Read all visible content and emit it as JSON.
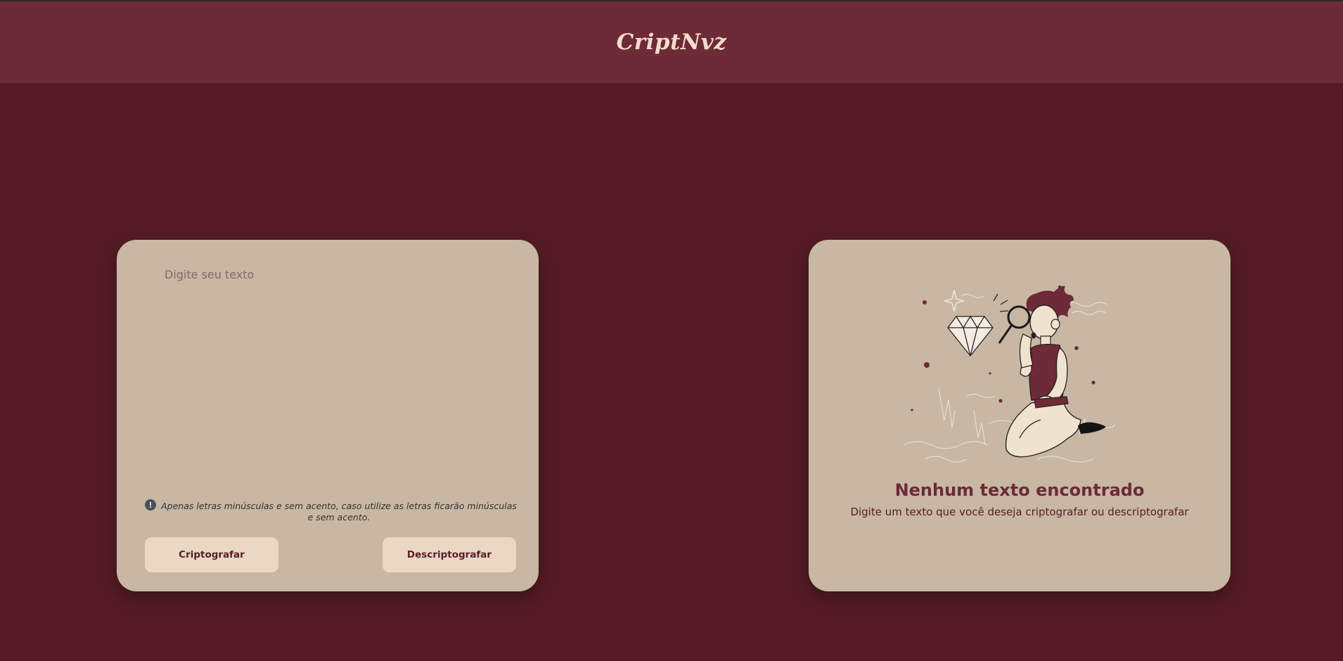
{
  "header": {
    "brand": "CriptNvz"
  },
  "input_card": {
    "placeholder": "Digite seu texto",
    "value": "",
    "hint_icon": "info-icon",
    "hint": "Apenas letras minúsculas e sem acento, caso utilize as letras ficarão minúsculas e sem acento.",
    "encrypt_label": "Criptografar",
    "decrypt_label": "Descriptografar"
  },
  "output_card": {
    "illustration": "person-with-magnifying-glass-illustration",
    "title": "Nenhum texto encontrado",
    "subtitle": "Digite um texto que você deseja criptografar ou descriptografar"
  },
  "colors": {
    "background": "#541b24",
    "header": "#6d2a37",
    "card": "#c7b7a3",
    "button": "#e8d8c4",
    "accent_text": "#6d2a37"
  }
}
